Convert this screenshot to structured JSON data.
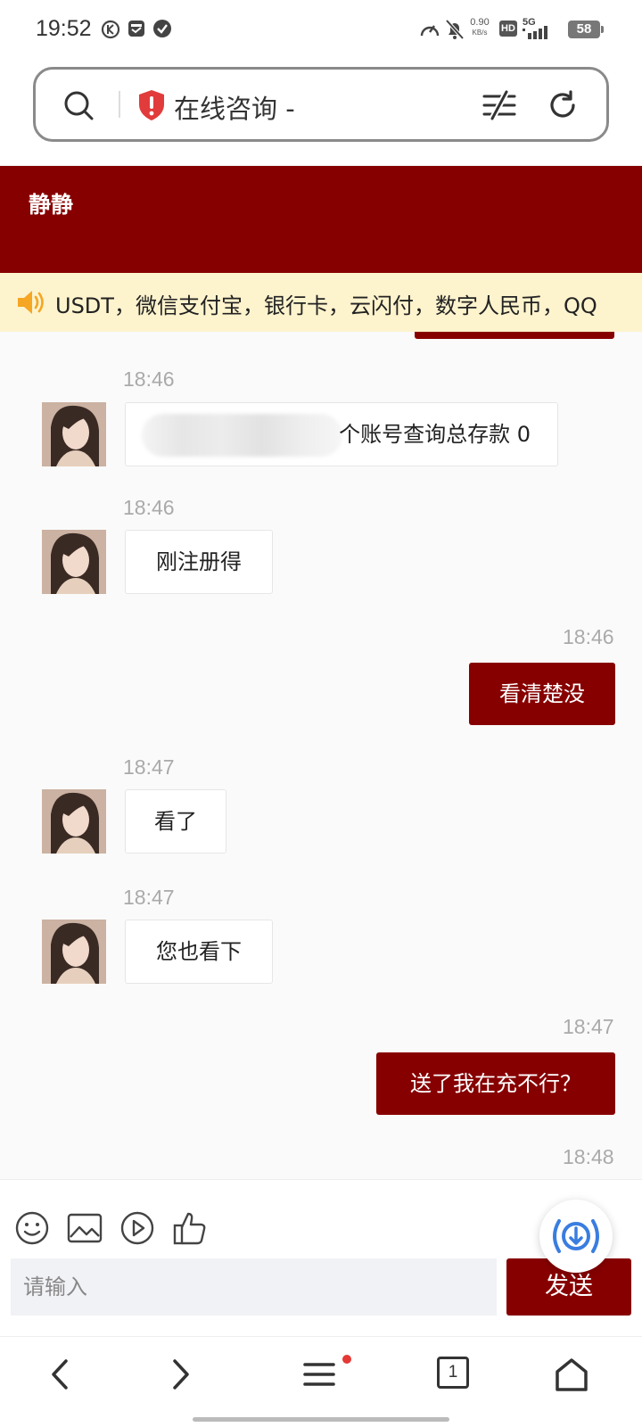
{
  "status_bar": {
    "time": "19:52",
    "net_speed_value": "0.90",
    "net_speed_unit": "KB/s",
    "hd_label": "HD",
    "network": "5G",
    "battery": "58"
  },
  "address_bar": {
    "title": "在线咨询 -"
  },
  "chat": {
    "contact_name": "静静",
    "notice_text": "USDT，微信支付宝，银行卡，云闪付，数字人民币，QQ"
  },
  "messages": [
    {
      "side": "in",
      "time": "18:46",
      "text": "个账号查询总存款 0"
    },
    {
      "side": "in",
      "time": "18:46",
      "text": "刚注册得"
    },
    {
      "side": "out",
      "time": "18:46",
      "text": "看清楚没"
    },
    {
      "side": "in",
      "time": "18:47",
      "text": "看了"
    },
    {
      "side": "in",
      "time": "18:47",
      "text": "您也看下"
    },
    {
      "side": "out",
      "time": "18:47",
      "text": "送了我在充不行？"
    },
    {
      "side": "out",
      "time": "18:48",
      "text": ""
    }
  ],
  "input": {
    "placeholder": "请输入",
    "send_label": "发送"
  },
  "tab_count": "1",
  "colors": {
    "brand": "#870000",
    "notice_bg": "#fdf3cd",
    "accent": "#3a7de0"
  },
  "icons": {
    "emoji": "smile-icon",
    "image": "image-icon",
    "video": "play-icon",
    "like": "thumbs-up-icon",
    "fab": "download-broadcast-icon"
  }
}
